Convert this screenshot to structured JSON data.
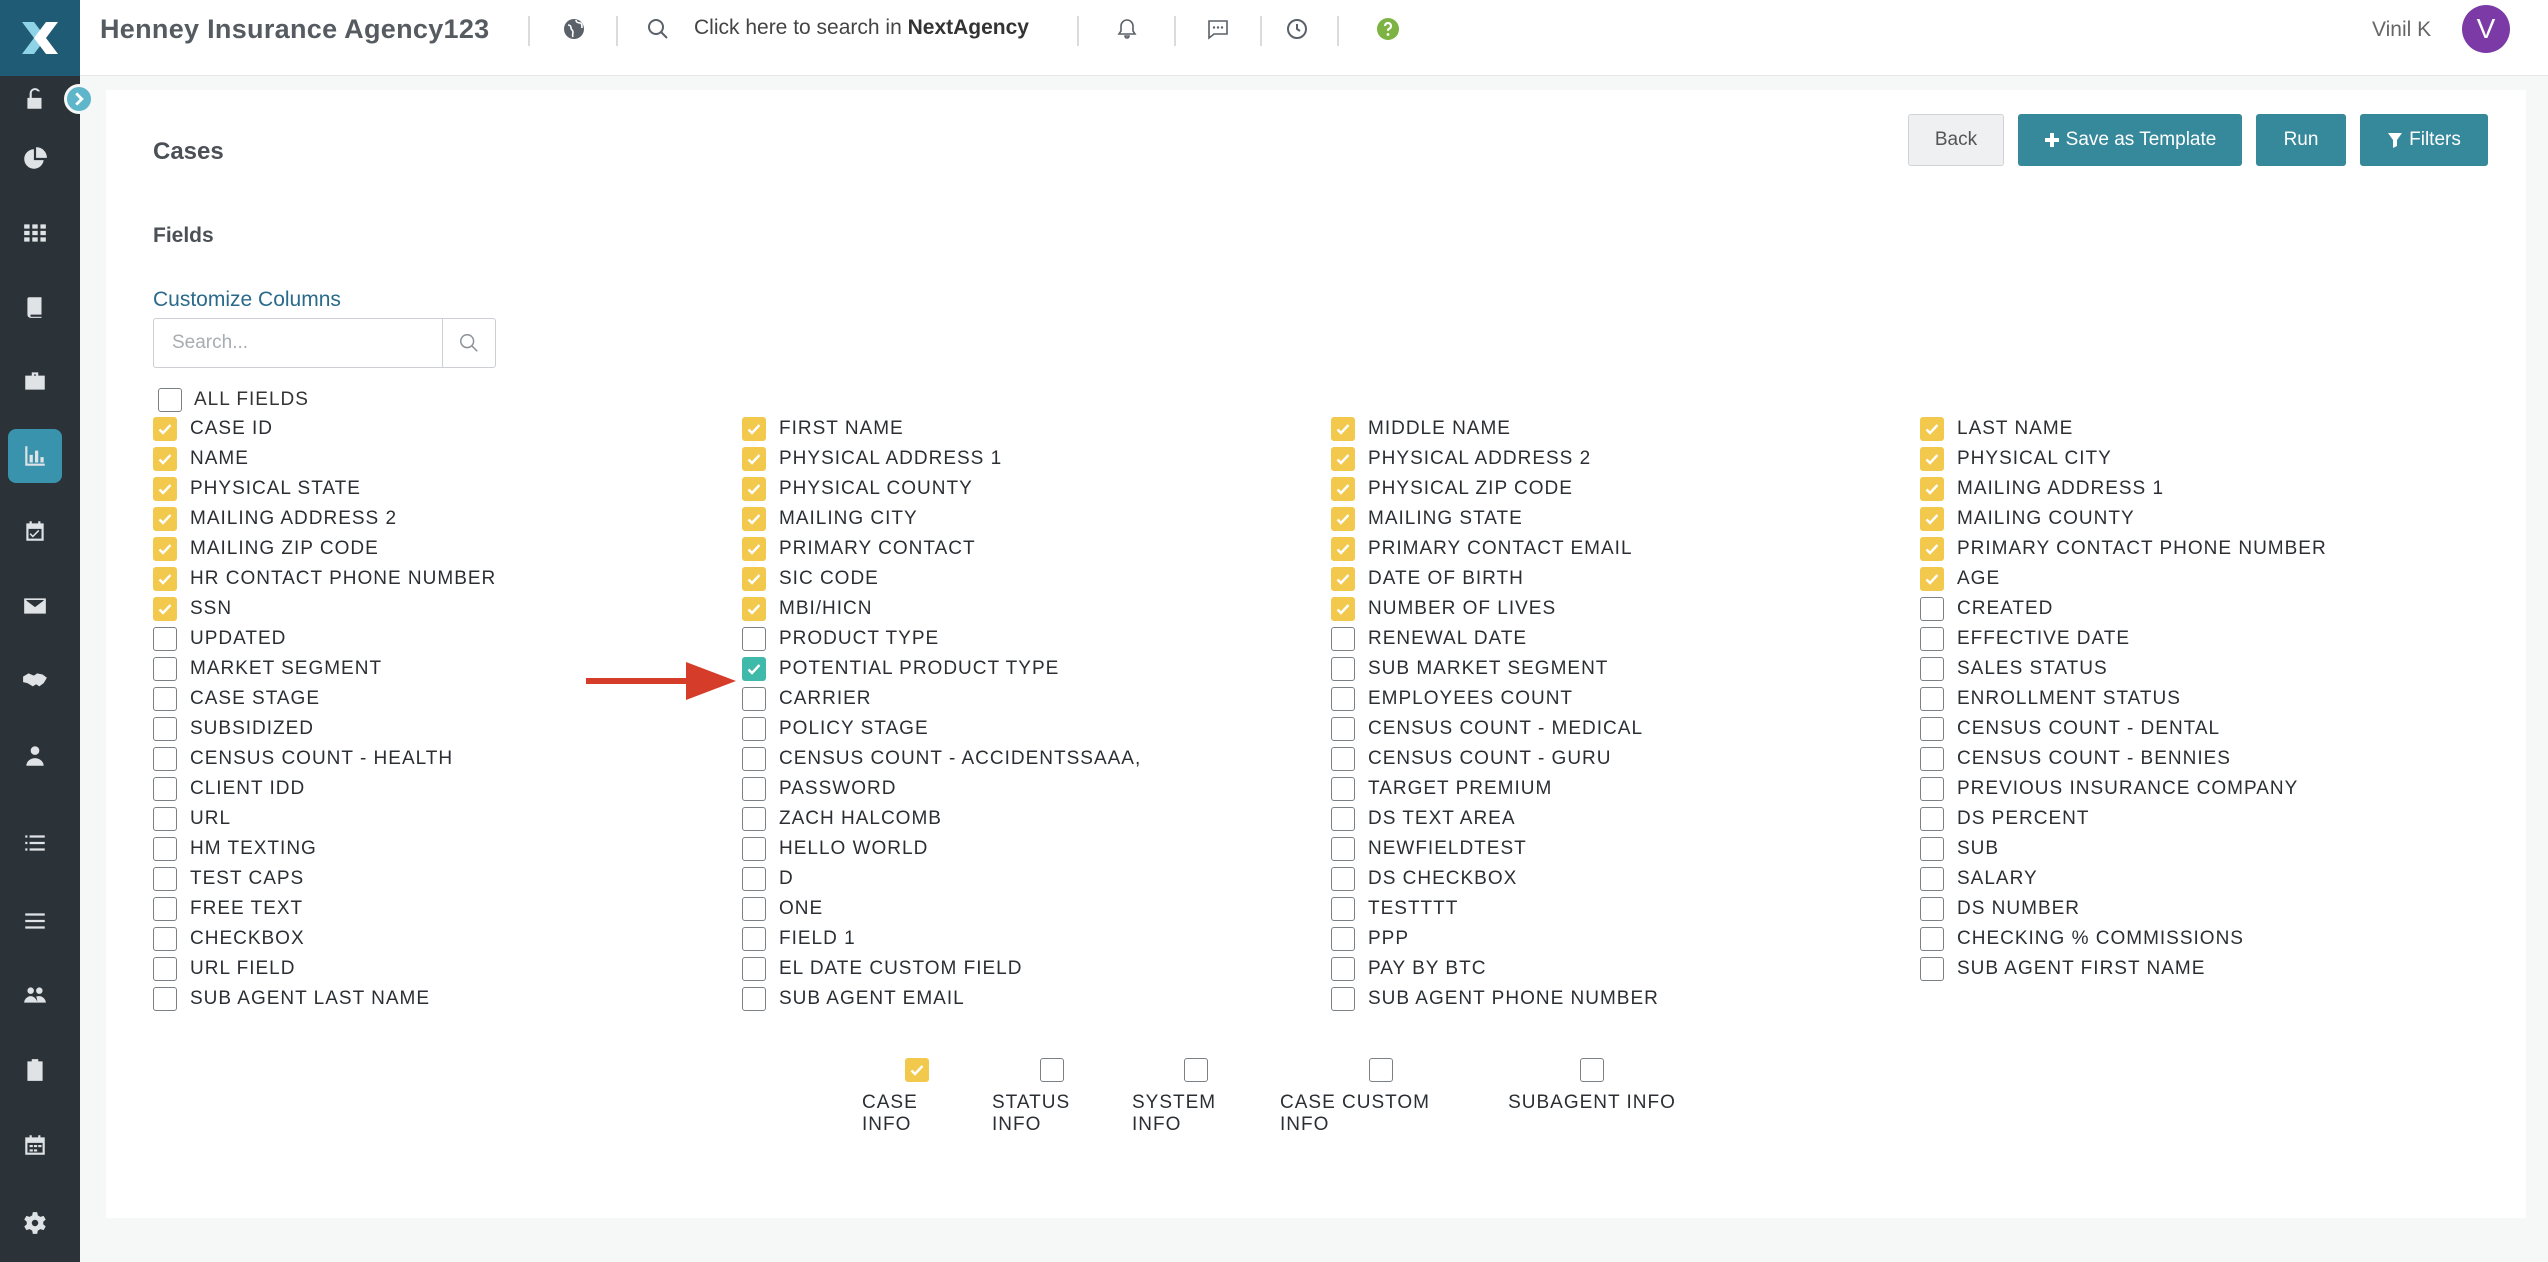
{
  "topbar": {
    "app_title": "Henney Insurance Agency123",
    "search_prefix": "Click here to search in ",
    "search_brand": "NextAgency",
    "user_name": "Vinil K",
    "avatar_initial": "V"
  },
  "page": {
    "title": "Cases",
    "section_title": "Fields",
    "customize_link": "Customize Columns",
    "search_placeholder": "Search...",
    "all_fields_label": "ALL FIELDS"
  },
  "buttons": {
    "back": "Back",
    "save_template": "Save as Template",
    "run": "Run",
    "filters": "Filters"
  },
  "fields": [
    {
      "label": "CASE ID",
      "checked": true
    },
    {
      "label": "FIRST NAME",
      "checked": true
    },
    {
      "label": "MIDDLE NAME",
      "checked": true
    },
    {
      "label": "LAST NAME",
      "checked": true
    },
    {
      "label": "NAME",
      "checked": true
    },
    {
      "label": "PHYSICAL ADDRESS 1",
      "checked": true
    },
    {
      "label": "PHYSICAL ADDRESS 2",
      "checked": true
    },
    {
      "label": "PHYSICAL CITY",
      "checked": true
    },
    {
      "label": "PHYSICAL STATE",
      "checked": true
    },
    {
      "label": "PHYSICAL COUNTY",
      "checked": true
    },
    {
      "label": "PHYSICAL ZIP CODE",
      "checked": true
    },
    {
      "label": "MAILING ADDRESS 1",
      "checked": true
    },
    {
      "label": "MAILING ADDRESS 2",
      "checked": true
    },
    {
      "label": "MAILING CITY",
      "checked": true
    },
    {
      "label": "MAILING STATE",
      "checked": true
    },
    {
      "label": "MAILING COUNTY",
      "checked": true
    },
    {
      "label": "MAILING ZIP CODE",
      "checked": true
    },
    {
      "label": "PRIMARY CONTACT",
      "checked": true
    },
    {
      "label": "PRIMARY CONTACT EMAIL",
      "checked": true
    },
    {
      "label": "PRIMARY CONTACT PHONE NUMBER",
      "checked": true
    },
    {
      "label": "HR CONTACT PHONE NUMBER",
      "checked": true
    },
    {
      "label": "SIC CODE",
      "checked": true
    },
    {
      "label": "DATE OF BIRTH",
      "checked": true
    },
    {
      "label": "AGE",
      "checked": true
    },
    {
      "label": "SSN",
      "checked": true
    },
    {
      "label": "MBI/HICN",
      "checked": true
    },
    {
      "label": "NUMBER OF LIVES",
      "checked": true
    },
    {
      "label": "CREATED",
      "checked": false
    },
    {
      "label": "UPDATED",
      "checked": false
    },
    {
      "label": "PRODUCT TYPE",
      "checked": false
    },
    {
      "label": "RENEWAL DATE",
      "checked": false
    },
    {
      "label": "EFFECTIVE DATE",
      "checked": false
    },
    {
      "label": "MARKET SEGMENT",
      "checked": false
    },
    {
      "label": "POTENTIAL PRODUCT TYPE",
      "checked": true,
      "highlight": true
    },
    {
      "label": "SUB MARKET SEGMENT",
      "checked": false
    },
    {
      "label": "SALES STATUS",
      "checked": false
    },
    {
      "label": "CASE STAGE",
      "checked": false
    },
    {
      "label": "CARRIER",
      "checked": false
    },
    {
      "label": "EMPLOYEES COUNT",
      "checked": false
    },
    {
      "label": "ENROLLMENT STATUS",
      "checked": false
    },
    {
      "label": "SUBSIDIZED",
      "checked": false
    },
    {
      "label": "POLICY STAGE",
      "checked": false
    },
    {
      "label": "CENSUS COUNT - MEDICAL",
      "checked": false
    },
    {
      "label": "CENSUS COUNT - DENTAL",
      "checked": false
    },
    {
      "label": "CENSUS COUNT - HEALTH",
      "checked": false
    },
    {
      "label": "CENSUS COUNT - ACCIDENTSSAAA,",
      "checked": false
    },
    {
      "label": "CENSUS COUNT - GURU",
      "checked": false
    },
    {
      "label": "CENSUS COUNT - BENNIES",
      "checked": false
    },
    {
      "label": "CLIENT IDD",
      "checked": false
    },
    {
      "label": "PASSWORD",
      "checked": false
    },
    {
      "label": "TARGET PREMIUM",
      "checked": false
    },
    {
      "label": "PREVIOUS INSURANCE COMPANY",
      "checked": false
    },
    {
      "label": "URL",
      "checked": false
    },
    {
      "label": "ZACH HALCOMB",
      "checked": false
    },
    {
      "label": "DS TEXT AREA",
      "checked": false
    },
    {
      "label": "DS PERCENT",
      "checked": false
    },
    {
      "label": "HM TEXTING",
      "checked": false
    },
    {
      "label": "HELLO WORLD",
      "checked": false
    },
    {
      "label": "NEWFIELDTEST",
      "checked": false
    },
    {
      "label": "SUB",
      "checked": false
    },
    {
      "label": "TEST CAPS",
      "checked": false
    },
    {
      "label": "D",
      "checked": false
    },
    {
      "label": "DS CHECKBOX",
      "checked": false
    },
    {
      "label": "SALARY",
      "checked": false
    },
    {
      "label": "FREE TEXT",
      "checked": false
    },
    {
      "label": "ONE",
      "checked": false
    },
    {
      "label": "TESTTTT",
      "checked": false
    },
    {
      "label": "DS NUMBER",
      "checked": false
    },
    {
      "label": "CHECKBOX",
      "checked": false
    },
    {
      "label": "FIELD 1",
      "checked": false
    },
    {
      "label": "PPP",
      "checked": false
    },
    {
      "label": "CHECKING % COMMISSIONS",
      "checked": false
    },
    {
      "label": "URL FIELD",
      "checked": false
    },
    {
      "label": "EL DATE CUSTOM FIELD",
      "checked": false
    },
    {
      "label": "PAY BY BTC",
      "checked": false
    },
    {
      "label": "SUB AGENT FIRST NAME",
      "checked": false
    },
    {
      "label": "SUB AGENT LAST NAME",
      "checked": false
    },
    {
      "label": "SUB AGENT EMAIL",
      "checked": false
    },
    {
      "label": "SUB AGENT PHONE NUMBER",
      "checked": false
    }
  ],
  "groups": [
    {
      "label": "CASE INFO",
      "checked": true
    },
    {
      "label": "STATUS INFO",
      "checked": false
    },
    {
      "label": "SYSTEM INFO",
      "checked": false
    },
    {
      "label": "CASE CUSTOM INFO",
      "checked": false
    },
    {
      "label": "SUBAGENT INFO",
      "checked": false
    }
  ],
  "colors": {
    "checked_yellow": "#f2c94c",
    "highlight_teal": "#3fb9a9",
    "accent_teal": "#36889b",
    "arrow_red": "#d63c2a",
    "sidebar": "#2b3238"
  },
  "sidebar_icons": [
    "lock-icon",
    "pie-chart-icon",
    "grid-icon",
    "book-icon",
    "briefcase-icon",
    "bar-chart-icon",
    "calendar-check-icon",
    "mail-icon",
    "handshake-icon",
    "user-icon",
    "list-icon",
    "menu-icon",
    "users-icon",
    "clipboard-icon",
    "calendar-icon",
    "settings-icon"
  ]
}
